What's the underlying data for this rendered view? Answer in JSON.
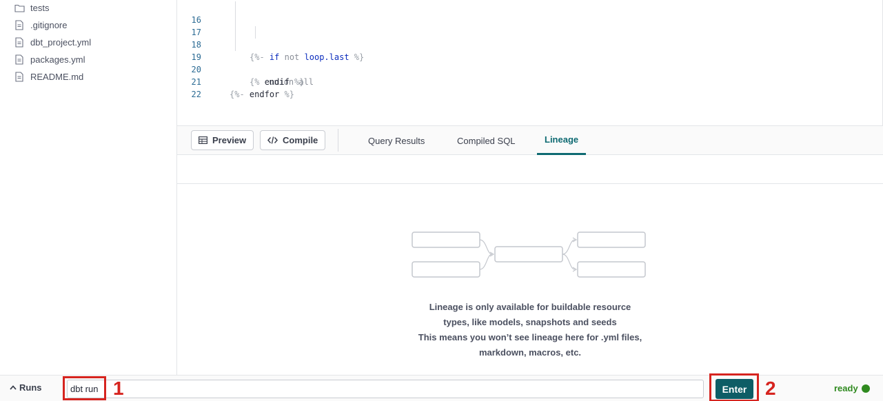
{
  "sidebar": {
    "items": [
      {
        "label": "tests",
        "icon": "folder-icon"
      },
      {
        "label": ".gitignore",
        "icon": "file-icon"
      },
      {
        "label": "dbt_project.yml",
        "icon": "file-icon"
      },
      {
        "label": "packages.yml",
        "icon": "file-icon"
      },
      {
        "label": "README.md",
        "icon": "file-icon"
      }
    ]
  },
  "editor": {
    "lines": [
      {
        "num": "16"
      },
      {
        "num": "17",
        "delim_open": "{%-",
        "kw": "if",
        "plain1": "not",
        "var": "loop.last",
        "delim_close": "%}"
      },
      {
        "num": "18",
        "text": "union all"
      },
      {
        "num": "19",
        "delim_open": "{%",
        "kw": "endif",
        "delim_close": "%}"
      },
      {
        "num": "20"
      },
      {
        "num": "21",
        "delim_open": "{%-",
        "kw": "endfor",
        "delim_close": "%}"
      },
      {
        "num": "22"
      }
    ]
  },
  "toolbar": {
    "preview_label": "Preview",
    "compile_label": "Compile"
  },
  "tabs": [
    {
      "label": "Query Results",
      "active": false
    },
    {
      "label": "Compiled SQL",
      "active": false
    },
    {
      "label": "Lineage",
      "active": true
    }
  ],
  "lineage": {
    "message_lines": [
      "Lineage is only available for buildable resource",
      "types, like models, snapshots and seeds",
      "This means you won’t see lineage here for .yml files,",
      "markdown, macros, etc."
    ]
  },
  "command_bar": {
    "runs_label": "Runs",
    "command_value": "dbt run",
    "enter_label": "Enter",
    "status_text": "ready"
  },
  "annotations": {
    "label_1": "1",
    "label_2": "2"
  },
  "colors": {
    "accent": "#0e5d66",
    "active_tab": "#0e6a72",
    "status_ready": "#2f8a1f",
    "highlight": "#d6241f"
  }
}
